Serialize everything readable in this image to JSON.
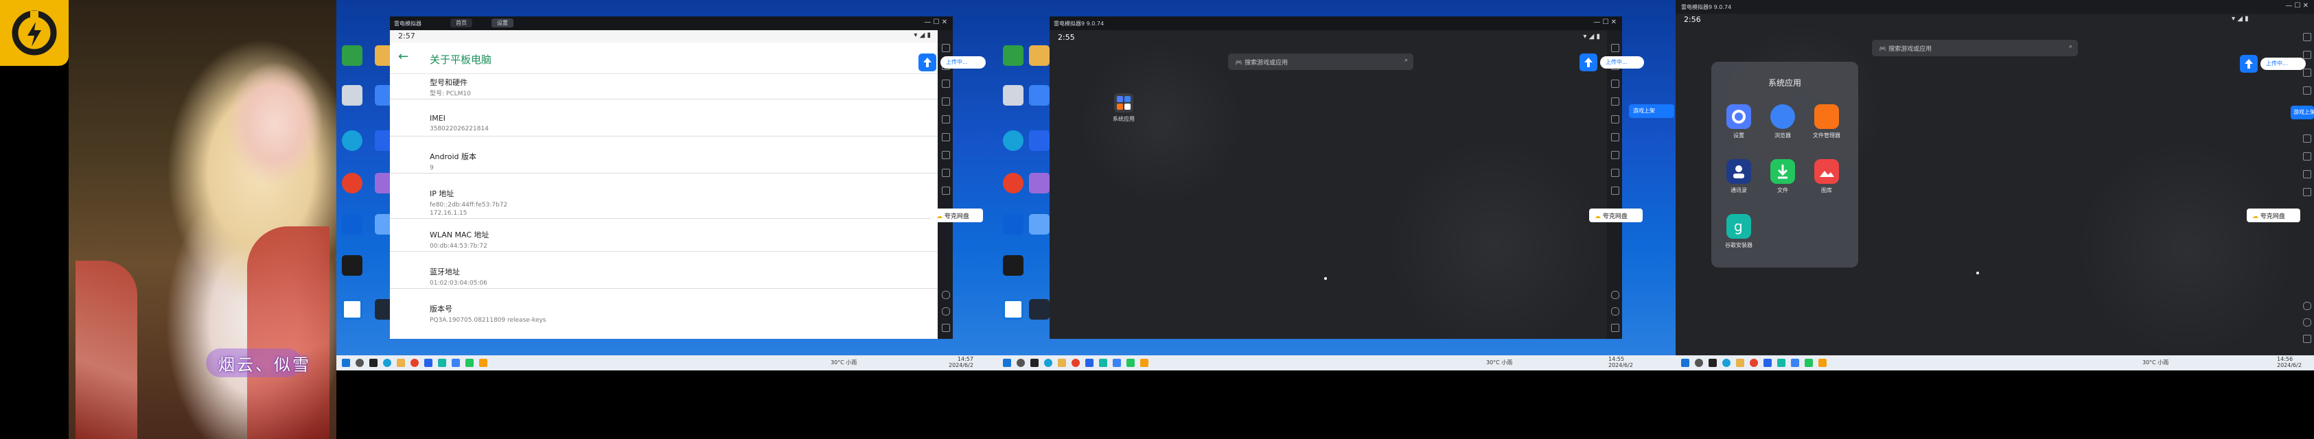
{
  "promo": {
    "caption": "烟云、似雪"
  },
  "colors": {
    "brand_yellow": "#f2b600",
    "android_green": "#1a8f5a",
    "desktop_blue": "#1454c8",
    "dark_home": "#232428"
  },
  "monitor1": {
    "emulator_title": "雷电模拟器",
    "tab1": "首页",
    "tab2": "设置",
    "status_time": "2:57",
    "screen_title": "关于平板电脑",
    "rows": [
      {
        "label": "型号和硬件",
        "value": "型号: PCLM10"
      },
      {
        "label": "IMEI",
        "value": "358022026221814"
      },
      {
        "label": "Android 版本",
        "value": "9"
      },
      {
        "label": "IP 地址",
        "value": "fe80::2db:44ff:fe53:7b72\n172.16.1.15"
      },
      {
        "label": "WLAN MAC 地址",
        "value": "00:db:44:53:7b:72"
      },
      {
        "label": "蓝牙地址",
        "value": "01:02:03:04:05:06"
      },
      {
        "label": "版本号",
        "value": "PQ3A.190705.08211809 release-keys"
      }
    ],
    "float_pill": "上传中...",
    "netdisk": "夸克网盘",
    "tray_weather": "30°C 小雨",
    "tray_time": "14:57",
    "tray_date": "2024/6/2"
  },
  "monitor2": {
    "emulator_title": "雷电模拟器9 9.0.74",
    "status_time": "2:55",
    "search_placeholder": "搜索游戏或应用",
    "folder_label": "系统应用",
    "float_pill": "上传中...",
    "side_pill": "游戏上架",
    "netdisk": "夸克网盘",
    "tray_weather": "30°C 小雨",
    "tray_time": "14:55",
    "tray_date": "2024/6/2"
  },
  "monitor3": {
    "emulator_title": "雷电模拟器9 9.0.74",
    "status_time": "2:56",
    "search_placeholder": "搜索游戏或应用",
    "folder_title": "系统应用",
    "apps": [
      "设置",
      "浏览器",
      "文件管理器",
      "通讯录",
      "文件",
      "图库",
      "谷歌安装器"
    ],
    "float_pill": "上传中...",
    "side_pill": "游戏上架",
    "netdisk": "夸克网盘",
    "tray_weather": "30°C 小雨",
    "tray_time": "14:56",
    "tray_date": "2024/6/2"
  }
}
